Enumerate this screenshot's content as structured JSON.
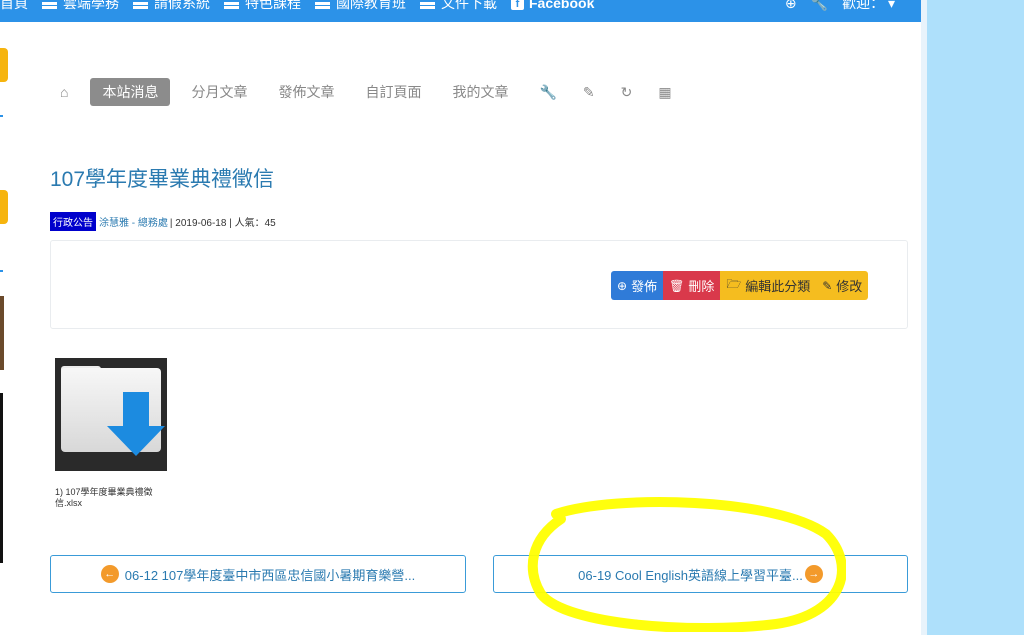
{
  "navbar": {
    "items": [
      {
        "label": "首頁",
        "icon": "none"
      },
      {
        "label": "雲端學務",
        "icon": "list-icon"
      },
      {
        "label": "請假系統",
        "icon": "list-icon"
      },
      {
        "label": "特色課程",
        "icon": "list-icon"
      },
      {
        "label": "國際教育班",
        "icon": "list-icon"
      },
      {
        "label": "文件下載",
        "icon": "list-icon"
      },
      {
        "label": "Facebook",
        "icon": "facebook-icon"
      }
    ],
    "welcome": "歡迎："
  },
  "tabs": [
    {
      "label": "本站消息",
      "active": true
    },
    {
      "label": "分月文章"
    },
    {
      "label": "發佈文章"
    },
    {
      "label": "自訂頁面"
    },
    {
      "label": "我的文章"
    }
  ],
  "article": {
    "title": "107學年度畢業典禮徵信",
    "category": "行政公告",
    "author": "涂慧雅 - 總務處",
    "meta_rest": "| 2019-06-18 | 人氣：45"
  },
  "actions": {
    "publish": "發佈",
    "delete": "刪除",
    "edit_category": "編輯此分類",
    "edit": "修改"
  },
  "attachment": {
    "filename": "1) 107學年度畢業典禮徵信.xlsx"
  },
  "pager": {
    "prev": "06-12 107學年度臺中市西區忠信國小暑期育樂營...",
    "next": "06-19 Cool English英語線上學習平臺..."
  },
  "colors": {
    "navbar": "#2c92e8",
    "title": "#2a7ab0",
    "publish": "#2f7bd8",
    "delete": "#d9394b",
    "edit": "#f5bd1f",
    "highlight": "#ffff00",
    "right_pane": "#aee0fb"
  }
}
